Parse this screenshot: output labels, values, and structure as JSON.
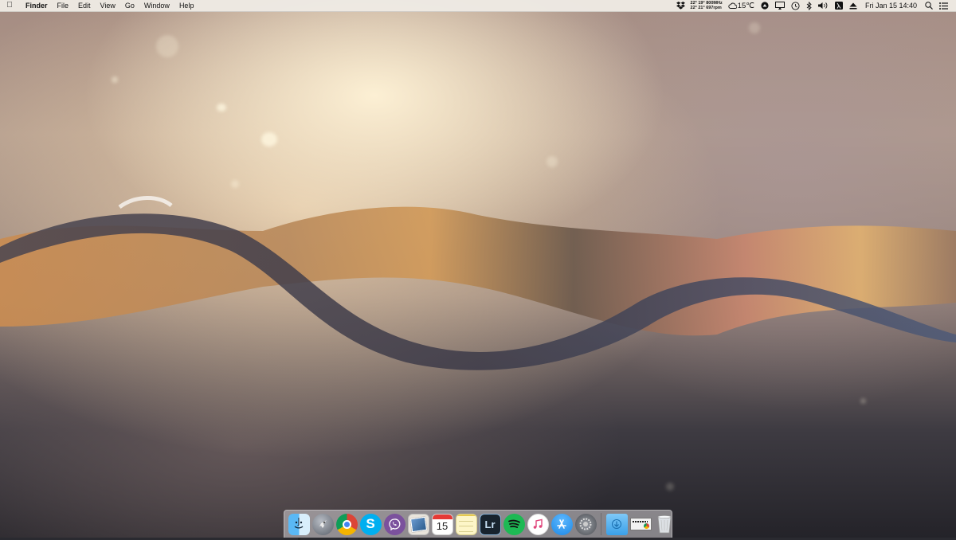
{
  "menubar": {
    "apple_icon": "apple-logo-icon",
    "app_name": "Finder",
    "menus": [
      "File",
      "Edit",
      "View",
      "Go",
      "Window",
      "Help"
    ],
    "status": {
      "sensor_line1": "22° 19° 800MHz",
      "sensor_line2": "22° 21° 697rpm",
      "weather_temp": "15℃",
      "clock": "Fri Jan 15  14:40"
    }
  },
  "dock": {
    "apps": [
      {
        "name": "Finder",
        "icon": "finder-icon",
        "running": true
      },
      {
        "name": "Launchpad",
        "icon": "launchpad-icon",
        "running": false
      },
      {
        "name": "Google Chrome",
        "icon": "chrome-icon",
        "running": true
      },
      {
        "name": "Skype",
        "icon": "skype-icon",
        "running": false
      },
      {
        "name": "Viber",
        "icon": "viber-icon",
        "running": false
      },
      {
        "name": "Preview",
        "icon": "preview-icon",
        "running": true
      },
      {
        "name": "Calendar",
        "icon": "calendar-icon",
        "running": false,
        "label": "15"
      },
      {
        "name": "Notes",
        "icon": "notes-icon",
        "running": false
      },
      {
        "name": "Lightroom",
        "icon": "lightroom-icon",
        "running": false,
        "label": "Lr"
      },
      {
        "name": "Spotify",
        "icon": "spotify-icon",
        "running": false
      },
      {
        "name": "iTunes",
        "icon": "itunes-icon",
        "running": false
      },
      {
        "name": "App Store",
        "icon": "app-store-icon",
        "running": false
      },
      {
        "name": "System Preferences",
        "icon": "system-preferences-icon",
        "running": false
      }
    ],
    "stacks": [
      {
        "name": "Downloads",
        "icon": "downloads-folder-icon"
      },
      {
        "name": "Documents",
        "icon": "documents-stack-icon"
      },
      {
        "name": "Trash",
        "icon": "trash-icon"
      }
    ]
  },
  "colors": {
    "menubar_bg": "#eeeae4",
    "chrome_red": "#db4437",
    "chrome_green": "#0f9d58",
    "chrome_yellow": "#f4b400",
    "skype_blue": "#00aff0",
    "viber_purple": "#7b519d",
    "spotify_green": "#1db954",
    "appstore_blue": "#1e88e5",
    "lightroom_bg": "#18232e"
  }
}
